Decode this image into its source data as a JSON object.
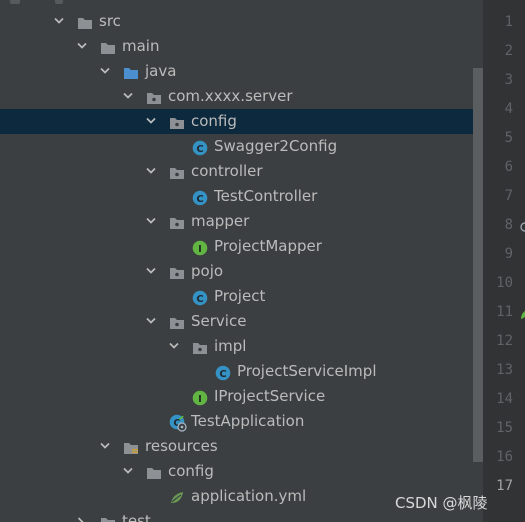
{
  "tree": {
    "rows": [
      {
        "label": "src",
        "icon": "folder-icon",
        "depth": 0,
        "expanded": true
      },
      {
        "label": "main",
        "icon": "folder-icon",
        "depth": 1,
        "expanded": true
      },
      {
        "label": "java",
        "icon": "source-folder-icon",
        "depth": 2,
        "expanded": true
      },
      {
        "label": "com.xxxx.server",
        "icon": "package-icon",
        "depth": 3,
        "expanded": true
      },
      {
        "label": "config",
        "icon": "package-icon",
        "depth": 4,
        "expanded": true,
        "selected": true
      },
      {
        "label": "Swagger2Config",
        "icon": "class-icon",
        "depth": 5
      },
      {
        "label": "controller",
        "icon": "package-icon",
        "depth": 4,
        "expanded": true
      },
      {
        "label": "TestController",
        "icon": "class-icon",
        "depth": 5
      },
      {
        "label": "mapper",
        "icon": "package-icon",
        "depth": 4,
        "expanded": true
      },
      {
        "label": "ProjectMapper",
        "icon": "interface-icon",
        "depth": 5
      },
      {
        "label": "pojo",
        "icon": "package-icon",
        "depth": 4,
        "expanded": true
      },
      {
        "label": "Project",
        "icon": "class-icon",
        "depth": 5
      },
      {
        "label": "Service",
        "icon": "package-icon",
        "depth": 4,
        "expanded": true
      },
      {
        "label": "impl",
        "icon": "package-icon",
        "depth": 5,
        "expanded": true
      },
      {
        "label": "ProjectServiceImpl",
        "icon": "class-icon",
        "depth": 6
      },
      {
        "label": "IProjectService",
        "icon": "interface-icon",
        "depth": 5
      },
      {
        "label": "TestApplication",
        "icon": "spring-boot-class-icon",
        "depth": 4
      },
      {
        "label": "resources",
        "icon": "resources-folder-icon",
        "depth": 2,
        "expanded": true
      },
      {
        "label": "config",
        "icon": "folder-icon",
        "depth": 3,
        "expanded": true
      },
      {
        "label": "application.yml",
        "icon": "spring-yml-icon",
        "depth": 4
      },
      {
        "label": "test",
        "icon": "folder-icon",
        "depth": 1,
        "expanded": false
      }
    ]
  },
  "gutter": {
    "line_numbers": [
      "1",
      "2",
      "3",
      "4",
      "5",
      "6",
      "7",
      "8",
      "9",
      "10",
      "11",
      "12",
      "13",
      "14",
      "15",
      "16",
      "17"
    ],
    "active_line": "17"
  },
  "watermark": "CSDN @枫陵",
  "colors": {
    "background": "#3c3f41",
    "selection": "#0d293e",
    "folder": "#8d9196",
    "source_folder": "#4b8fd1",
    "class": "#3592c4",
    "interface": "#62b543",
    "gutter": "#313335"
  }
}
